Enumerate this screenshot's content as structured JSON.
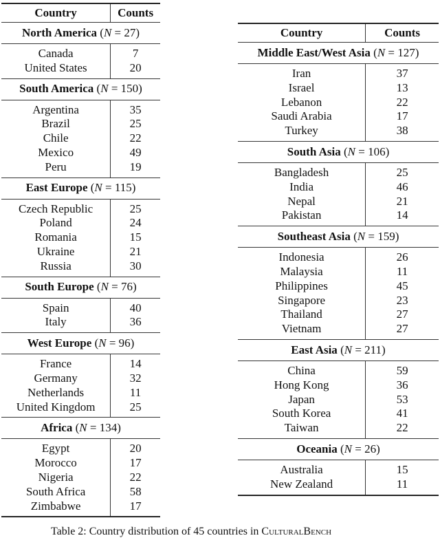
{
  "headers": {
    "country": "Country",
    "counts": "Counts"
  },
  "left_regions": [
    {
      "name": "North America",
      "n": "27",
      "rows": [
        [
          "Canada",
          "7"
        ],
        [
          "United States",
          "20"
        ]
      ]
    },
    {
      "name": "South America",
      "n": "150",
      "rows": [
        [
          "Argentina",
          "35"
        ],
        [
          "Brazil",
          "25"
        ],
        [
          "Chile",
          "22"
        ],
        [
          "Mexico",
          "49"
        ],
        [
          "Peru",
          "19"
        ]
      ]
    },
    {
      "name": "East Europe",
      "n": "115",
      "rows": [
        [
          "Czech Republic",
          "25"
        ],
        [
          "Poland",
          "24"
        ],
        [
          "Romania",
          "15"
        ],
        [
          "Ukraine",
          "21"
        ],
        [
          "Russia",
          "30"
        ]
      ]
    },
    {
      "name": "South Europe",
      "n": "76",
      "rows": [
        [
          "Spain",
          "40"
        ],
        [
          "Italy",
          "36"
        ]
      ]
    },
    {
      "name": "West Europe",
      "n": "96",
      "rows": [
        [
          "France",
          "14"
        ],
        [
          "Germany",
          "32"
        ],
        [
          "Netherlands",
          "11"
        ],
        [
          "United Kingdom",
          "25"
        ]
      ]
    },
    {
      "name": "Africa",
      "n": "134",
      "rows": [
        [
          "Egypt",
          "20"
        ],
        [
          "Morocco",
          "17"
        ],
        [
          "Nigeria",
          "22"
        ],
        [
          "South Africa",
          "58"
        ],
        [
          "Zimbabwe",
          "17"
        ]
      ]
    }
  ],
  "right_regions": [
    {
      "name": "Middle East/West Asia",
      "n": "127",
      "rows": [
        [
          "Iran",
          "37"
        ],
        [
          "Israel",
          "13"
        ],
        [
          "Lebanon",
          "22"
        ],
        [
          "Saudi Arabia",
          "17"
        ],
        [
          "Turkey",
          "38"
        ]
      ]
    },
    {
      "name": "South Asia",
      "n": "106",
      "rows": [
        [
          "Bangladesh",
          "25"
        ],
        [
          "India",
          "46"
        ],
        [
          "Nepal",
          "21"
        ],
        [
          "Pakistan",
          "14"
        ]
      ]
    },
    {
      "name": "Southeast Asia",
      "n": "159",
      "rows": [
        [
          "Indonesia",
          "26"
        ],
        [
          "Malaysia",
          "11"
        ],
        [
          "Philippines",
          "45"
        ],
        [
          "Singapore",
          "23"
        ],
        [
          "Thailand",
          "27"
        ],
        [
          "Vietnam",
          "27"
        ]
      ]
    },
    {
      "name": "East Asia",
      "n": "211",
      "rows": [
        [
          "China",
          "59"
        ],
        [
          "Hong Kong",
          "36"
        ],
        [
          "Japan",
          "53"
        ],
        [
          "South Korea",
          "41"
        ],
        [
          "Taiwan",
          "22"
        ]
      ]
    },
    {
      "name": "Oceania",
      "n": "26",
      "rows": [
        [
          "Australia",
          "15"
        ],
        [
          "New Zealand",
          "11"
        ]
      ]
    }
  ],
  "n_symbol": "N",
  "caption": {
    "prefix": "Table 2: Country distribution of 45 countries in ",
    "benchmark": "CulturalBench"
  }
}
